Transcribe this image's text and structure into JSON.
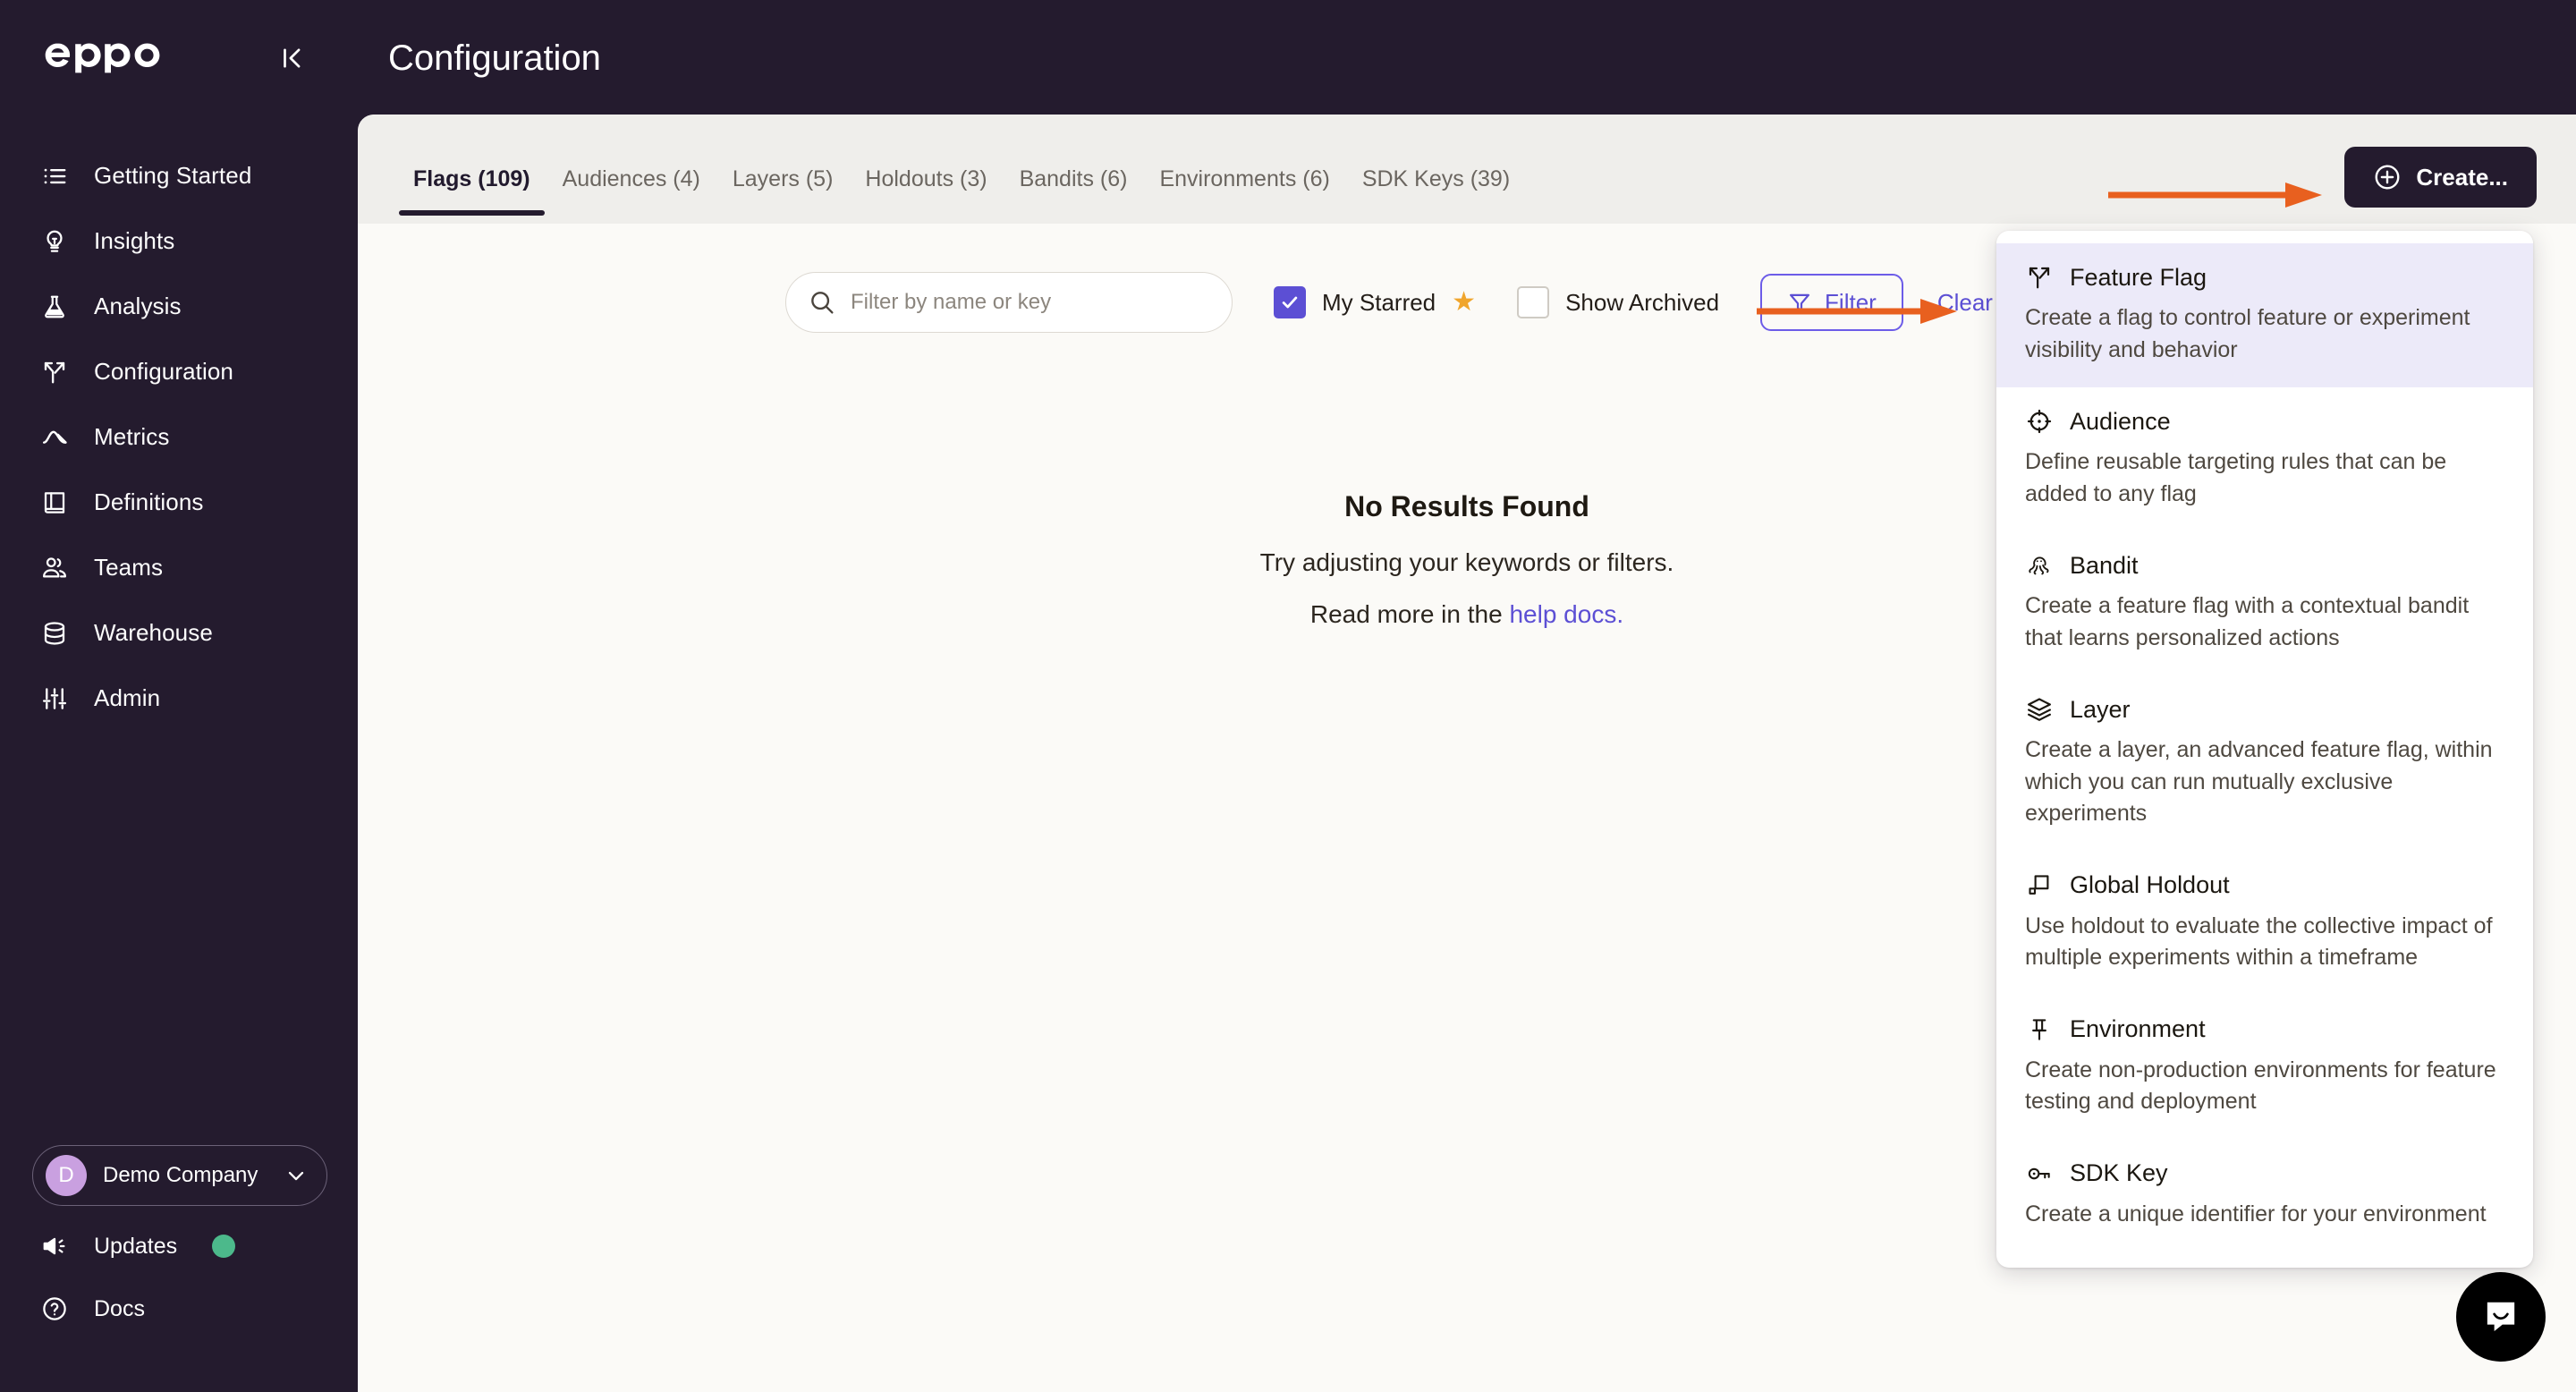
{
  "app": {
    "logo_text": "eppo",
    "collapse_icon": "collapse-sidebar-icon"
  },
  "header": {
    "title": "Configuration"
  },
  "sidebar": {
    "items": [
      {
        "label": "Getting Started",
        "icon": "list-icon"
      },
      {
        "label": "Insights",
        "icon": "lightbulb-icon"
      },
      {
        "label": "Analysis",
        "icon": "flask-icon"
      },
      {
        "label": "Configuration",
        "icon": "branch-icon"
      },
      {
        "label": "Metrics",
        "icon": "chart-line-icon"
      },
      {
        "label": "Definitions",
        "icon": "book-icon"
      },
      {
        "label": "Teams",
        "icon": "people-icon"
      },
      {
        "label": "Warehouse",
        "icon": "database-icon"
      },
      {
        "label": "Admin",
        "icon": "sliders-icon"
      }
    ],
    "company": {
      "avatar_letter": "D",
      "name": "Demo Company",
      "chevron": "chevron-down-icon"
    },
    "updates": {
      "label": "Updates",
      "icon": "megaphone-icon",
      "has_badge": true
    },
    "docs": {
      "label": "Docs",
      "icon": "question-circle-icon"
    }
  },
  "tabs": [
    {
      "label": "Flags (109)",
      "active": true
    },
    {
      "label": "Audiences (4)",
      "active": false
    },
    {
      "label": "Layers (5)",
      "active": false
    },
    {
      "label": "Holdouts (3)",
      "active": false
    },
    {
      "label": "Bandits (6)",
      "active": false
    },
    {
      "label": "Environments (6)",
      "active": false
    },
    {
      "label": "SDK Keys (39)",
      "active": false
    }
  ],
  "toolbar": {
    "create_label": "Create...",
    "create_icon": "plus-circle-icon"
  },
  "filters": {
    "search_placeholder": "Filter by name or key",
    "search_value": "",
    "search_icon": "search-icon",
    "my_starred": {
      "label": "My Starred",
      "checked": true,
      "star_icon": "star-icon"
    },
    "show_archived": {
      "label": "Show Archived",
      "checked": false
    },
    "filter_button": {
      "label": "Filter",
      "icon": "funnel-icon"
    },
    "clear_all": "Clear all"
  },
  "empty_state": {
    "title": "No Results Found",
    "line1": "Try adjusting your keywords or filters.",
    "line2_prefix": "Read more in the ",
    "line2_link": "help docs."
  },
  "create_menu": {
    "items": [
      {
        "title": "Feature Flag",
        "icon": "branch-icon",
        "description": "Create a flag to control feature or experiment visibility and behavior",
        "highlighted": true
      },
      {
        "title": "Audience",
        "icon": "target-icon",
        "description": "Define reusable targeting rules that can be added to any flag",
        "highlighted": false
      },
      {
        "title": "Bandit",
        "icon": "octopus-icon",
        "description": "Create a feature flag with a contextual bandit that learns personalized actions",
        "highlighted": false
      },
      {
        "title": "Layer",
        "icon": "layers-icon",
        "description": "Create a layer, an advanced feature flag, within which you can run mutually exclusive experiments",
        "highlighted": false
      },
      {
        "title": "Global Holdout",
        "icon": "holdout-square-icon",
        "description": "Use holdout to evaluate the collective impact of multiple experiments within a timeframe",
        "highlighted": false
      },
      {
        "title": "Environment",
        "icon": "pin-icon",
        "description": "Create non-production environments for feature testing and deployment",
        "highlighted": false
      },
      {
        "title": "SDK Key",
        "icon": "key-icon",
        "description": "Create a unique identifier for your environment",
        "highlighted": false
      }
    ]
  },
  "annotations": {
    "arrow_color": "#e8601f",
    "arrow1": "arrow-pointing-to-create-button",
    "arrow2": "arrow-pointing-to-feature-flag-item"
  },
  "widgets": {
    "intercom": "chat-bubble-icon"
  },
  "colors": {
    "sidebar_bg": "#241b2e",
    "panel_bg": "#fbfaf7",
    "tabbar_bg": "#efeeeb",
    "accent_purple": "#5c4fd4",
    "highlight_row": "#eceaf9",
    "orange": "#e8601f",
    "green_badge": "#4cb98b",
    "avatar": "#c9a0e0",
    "star": "#f0a52c"
  }
}
